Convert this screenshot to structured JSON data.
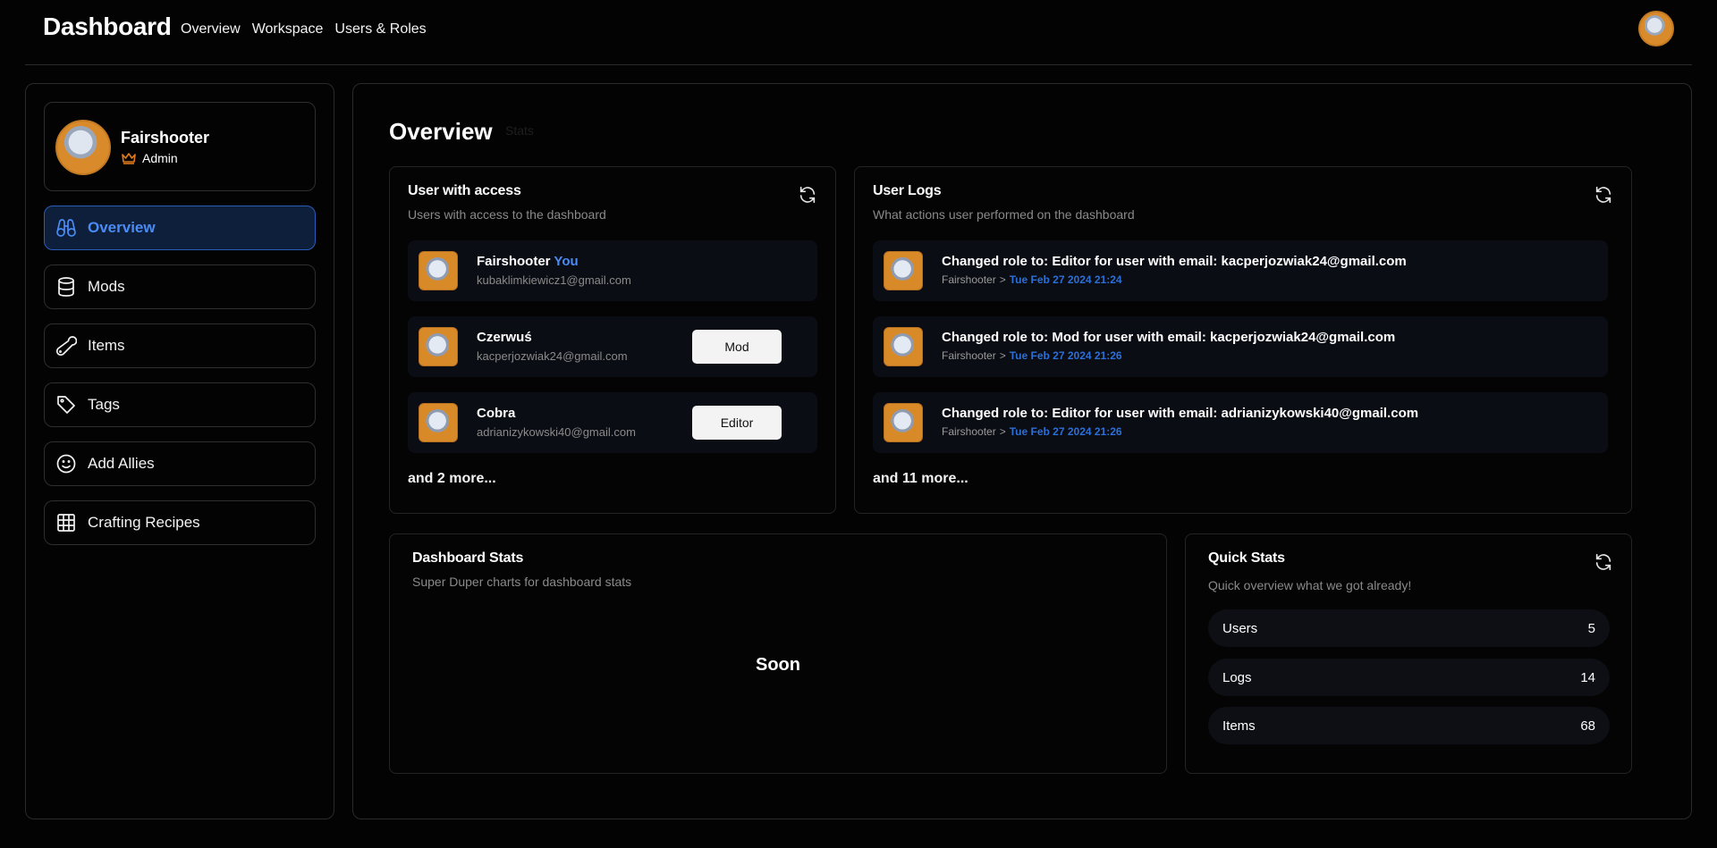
{
  "header": {
    "title": "Dashboard",
    "nav": [
      "Overview",
      "Workspace",
      "Users & Roles"
    ]
  },
  "sidebar": {
    "profile": {
      "name": "Fairshooter",
      "role": "Admin"
    },
    "items": [
      {
        "label": "Overview",
        "icon": "binoculars-icon",
        "active": true
      },
      {
        "label": "Mods",
        "icon": "database-icon"
      },
      {
        "label": "Items",
        "icon": "wrench-icon"
      },
      {
        "label": "Tags",
        "icon": "tag-icon"
      },
      {
        "label": "Add Allies",
        "icon": "smile-icon"
      },
      {
        "label": "Crafting Recipes",
        "icon": "grid-icon"
      }
    ]
  },
  "main": {
    "title": "Overview",
    "ghost": "Stats",
    "access": {
      "title": "User with access",
      "subtitle": "Users with access to the dashboard",
      "users": [
        {
          "name": "Fairshooter",
          "badge": "You",
          "email": "kubaklimkiewicz1@gmail.com"
        },
        {
          "name": "Czerwuś",
          "email": "kacperjozwiak24@gmail.com",
          "role": "Mod"
        },
        {
          "name": "Cobra",
          "email": "adrianizykowski40@gmail.com",
          "role": "Editor"
        }
      ],
      "more": "and 2 more..."
    },
    "logs": {
      "title": "User Logs",
      "subtitle": "What actions user performed on the dashboard",
      "entries": [
        {
          "action": "Changed role to: Editor for user with email: kacperjozwiak24@gmail.com",
          "user": "Fairshooter",
          "sep": ">",
          "date": "Tue Feb 27 2024 21:24"
        },
        {
          "action": "Changed role to: Mod for user with email: kacperjozwiak24@gmail.com",
          "user": "Fairshooter",
          "sep": ">",
          "date": "Tue Feb 27 2024 21:26"
        },
        {
          "action": "Changed role to: Editor for user with email: adrianizykowski40@gmail.com",
          "user": "Fairshooter",
          "sep": ">",
          "date": "Tue Feb 27 2024 21:26"
        }
      ],
      "more": "and 11 more..."
    },
    "dashStats": {
      "title": "Dashboard Stats",
      "subtitle": "Super Duper charts for dashboard stats",
      "placeholder": "Soon"
    },
    "quickStats": {
      "title": "Quick Stats",
      "subtitle": "Quick overview what we got already!",
      "rows": [
        {
          "label": "Users",
          "value": "5"
        },
        {
          "label": "Logs",
          "value": "14"
        },
        {
          "label": "Items",
          "value": "68"
        }
      ]
    }
  },
  "colors": {
    "accent": "#4a8bf5",
    "bg": "#030303",
    "date": "#2c6fd6"
  }
}
